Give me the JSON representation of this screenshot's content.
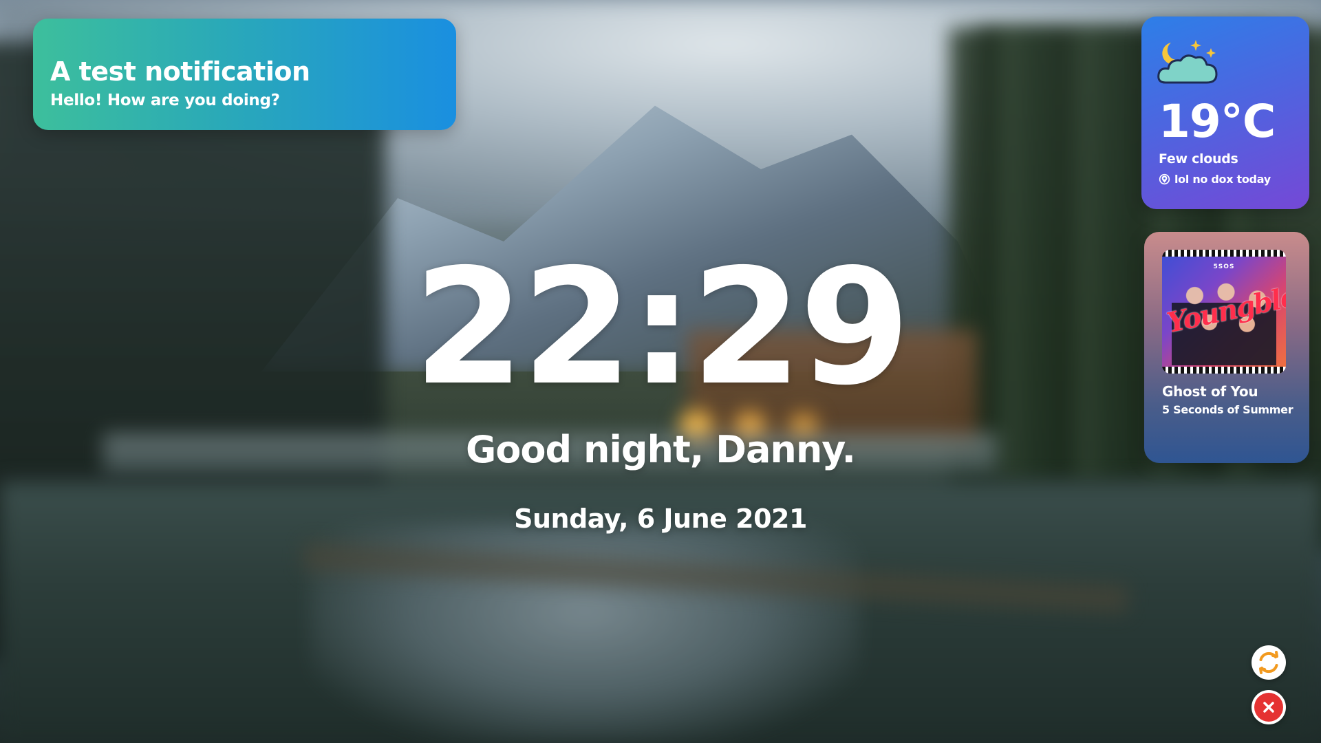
{
  "notification": {
    "title": "A test notification",
    "body": "Hello! How are you doing?"
  },
  "weather": {
    "icon": "night-cloud-icon",
    "temperature": "19°C",
    "condition": "Few clouds",
    "location": "lol no dox today"
  },
  "music": {
    "album_art_text": "5SOS",
    "album_art_script": "Youngblood",
    "song": "Ghost of You",
    "artist": "5 Seconds of Summer"
  },
  "clock": {
    "time": "22:29",
    "greeting": "Good night, Danny.",
    "date": "Sunday, 6 June 2021"
  },
  "actions": {
    "refresh_icon": "refresh-icon",
    "close_icon": "close-icon"
  },
  "colors": {
    "notification_start": "#3dbf9c",
    "notification_end": "#1a8fe0",
    "weather_start": "#2d7fe8",
    "weather_end": "#7548d6",
    "refresh_accent": "#f29a1f",
    "close_accent": "#e53232"
  }
}
